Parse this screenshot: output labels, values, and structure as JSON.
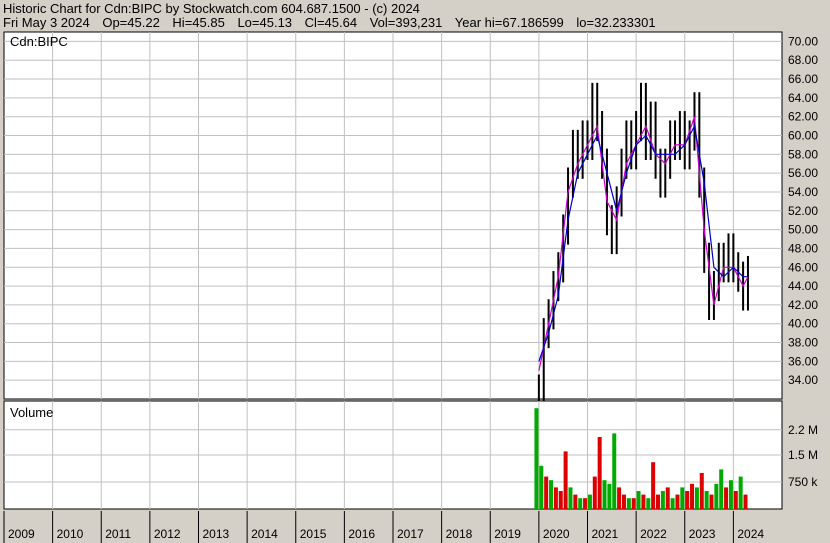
{
  "header": {
    "line1": "Historic Chart for Cdn:BIPC by Stockwatch.com 604.687.1500 - (c) 2024",
    "date": "Fri May  3 2024",
    "open": "Op=45.22",
    "high": "Hi=45.85",
    "low": "Lo=45.13",
    "close": "Cl=45.64",
    "volume": "Vol=393,231",
    "year_hi": "Year hi=67.186599",
    "year_lo": "lo=32.233301"
  },
  "colors": {
    "background": "#d4d0c8",
    "plot_background": "#ffffff",
    "grid": "#c0c0c0",
    "candle": "#000000",
    "ma_short": "#cc00cc",
    "ma_long": "#0000cc",
    "volume_up": "#00aa00",
    "volume_down": "#dd0000"
  },
  "chart_data": [
    {
      "type": "line",
      "panel_label": "Cdn:BIPC",
      "ylim": [
        32,
        71
      ],
      "yticks": [
        "34.00",
        "36.00",
        "38.00",
        "40.00",
        "42.00",
        "44.00",
        "46.00",
        "48.00",
        "50.00",
        "52.00",
        "54.00",
        "56.00",
        "58.00",
        "60.00",
        "62.00",
        "64.00",
        "66.00",
        "68.00",
        "70.00"
      ],
      "x_categories": [
        "2009",
        "2010",
        "2011",
        "2012",
        "2013",
        "2014",
        "2015",
        "2016",
        "2017",
        "2018",
        "2019",
        "2020",
        "2021",
        "2022",
        "2023",
        "2024"
      ],
      "grid": true,
      "series": [
        {
          "style": "price-bars",
          "x": [
            2020.0,
            2020.1,
            2020.2,
            2020.3,
            2020.4,
            2020.5,
            2020.6,
            2020.7,
            2020.8,
            2020.9,
            2021.0,
            2021.1,
            2021.2,
            2021.3,
            2021.4,
            2021.5,
            2021.6,
            2021.7,
            2021.8,
            2021.9,
            2022.0,
            2022.1,
            2022.2,
            2022.3,
            2022.4,
            2022.5,
            2022.6,
            2022.7,
            2022.8,
            2022.9,
            2023.0,
            2023.1,
            2023.2,
            2023.3,
            2023.4,
            2023.5,
            2023.6,
            2023.7,
            2023.8,
            2023.9,
            2024.0,
            2024.1,
            2024.2,
            2024.3
          ],
          "y": [
            33,
            39,
            41,
            44,
            46,
            50,
            55,
            59,
            57,
            60,
            59,
            64,
            61,
            57,
            51,
            49,
            53,
            57,
            60,
            58,
            61,
            64,
            59,
            62,
            57,
            55,
            57,
            60,
            59,
            61,
            58,
            60,
            63,
            55,
            47,
            42,
            44,
            47,
            46,
            48,
            46,
            45,
            43,
            45.6
          ]
        },
        {
          "name": "",
          "style": "ma-short",
          "x": [
            2020.0,
            2020.2,
            2020.4,
            2020.6,
            2020.8,
            2021.0,
            2021.2,
            2021.4,
            2021.6,
            2021.8,
            2022.0,
            2022.2,
            2022.4,
            2022.6,
            2022.8,
            2023.0,
            2023.2,
            2023.4,
            2023.6,
            2023.8,
            2024.0,
            2024.2,
            2024.3
          ],
          "y": [
            35,
            40,
            45,
            54,
            57,
            59,
            61,
            53,
            51,
            57,
            59,
            61,
            58,
            57,
            59,
            59,
            62,
            50,
            42,
            46,
            46,
            44,
            45
          ]
        },
        {
          "name": "",
          "style": "ma-long",
          "x": [
            2020.0,
            2020.2,
            2020.4,
            2020.6,
            2020.8,
            2021.0,
            2021.2,
            2021.4,
            2021.6,
            2021.8,
            2022.0,
            2022.2,
            2022.4,
            2022.6,
            2022.8,
            2023.0,
            2023.2,
            2023.4,
            2023.6,
            2023.8,
            2024.0,
            2024.2,
            2024.3
          ],
          "y": [
            36,
            39,
            43,
            51,
            56,
            58,
            60,
            56,
            52,
            56,
            59,
            60,
            58,
            58,
            58,
            59,
            61,
            55,
            46,
            45,
            46,
            45,
            45
          ]
        }
      ]
    },
    {
      "type": "bar",
      "panel_label": "Volume",
      "ylim": [
        0,
        3.0
      ],
      "yticks": [
        "750 k",
        "1.5 M",
        "2.2 M"
      ],
      "ytick_values": [
        0.75,
        1.5,
        2.2
      ],
      "unit": "millions of shares",
      "x": [
        2019.95,
        2020.05,
        2020.15,
        2020.25,
        2020.35,
        2020.45,
        2020.55,
        2020.65,
        2020.75,
        2020.85,
        2020.95,
        2021.05,
        2021.15,
        2021.25,
        2021.35,
        2021.45,
        2021.55,
        2021.65,
        2021.75,
        2021.85,
        2021.95,
        2022.05,
        2022.15,
        2022.25,
        2022.35,
        2022.45,
        2022.55,
        2022.65,
        2022.75,
        2022.85,
        2022.95,
        2023.05,
        2023.15,
        2023.25,
        2023.35,
        2023.45,
        2023.55,
        2023.65,
        2023.75,
        2023.85,
        2023.95,
        2024.05,
        2024.15,
        2024.25
      ],
      "values": [
        2.8,
        1.2,
        0.9,
        0.8,
        0.6,
        0.5,
        1.6,
        0.6,
        0.4,
        0.3,
        0.3,
        0.4,
        0.9,
        2.0,
        0.8,
        0.7,
        2.1,
        0.6,
        0.4,
        0.3,
        0.3,
        0.5,
        0.4,
        0.3,
        1.3,
        0.4,
        0.5,
        0.6,
        0.3,
        0.4,
        0.6,
        0.5,
        0.7,
        0.6,
        1.0,
        0.5,
        0.4,
        0.7,
        1.1,
        0.6,
        0.8,
        0.5,
        0.9,
        0.4
      ],
      "colors": [
        "up",
        "up",
        "down",
        "up",
        "down",
        "down",
        "down",
        "up",
        "down",
        "up",
        "down",
        "up",
        "down",
        "down",
        "up",
        "up",
        "up",
        "down",
        "down",
        "up",
        "down",
        "up",
        "down",
        "up",
        "down",
        "down",
        "up",
        "down",
        "up",
        "down",
        "up",
        "down",
        "down",
        "up",
        "down",
        "up",
        "down",
        "up",
        "up",
        "down",
        "up",
        "down",
        "up",
        "down"
      ]
    }
  ]
}
